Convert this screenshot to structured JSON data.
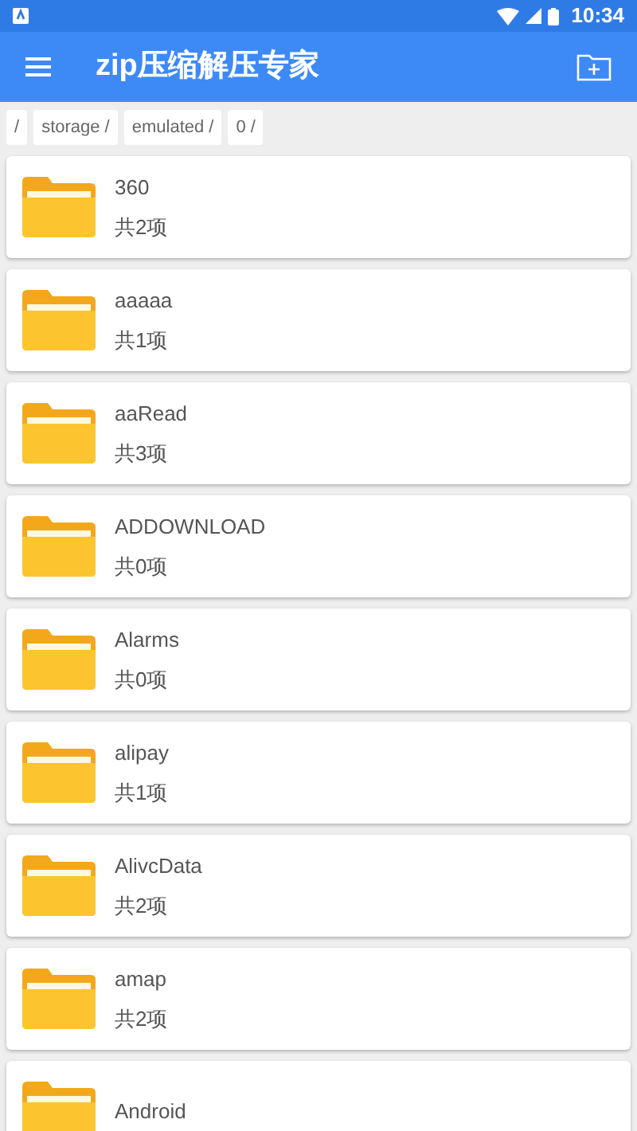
{
  "status_bar": {
    "time": "10:34"
  },
  "toolbar": {
    "title": "zip压缩解压专家"
  },
  "breadcrumb": [
    "/",
    "storage /",
    "emulated /",
    "0 /"
  ],
  "folders": [
    {
      "name": "360",
      "count": "共2项"
    },
    {
      "name": "aaaaa",
      "count": "共1项"
    },
    {
      "name": "aaRead",
      "count": "共3项"
    },
    {
      "name": "ADDOWNLOAD",
      "count": "共0项"
    },
    {
      "name": "Alarms",
      "count": "共0项"
    },
    {
      "name": "alipay",
      "count": "共1项"
    },
    {
      "name": "AlivcData",
      "count": "共2项"
    },
    {
      "name": "amap",
      "count": "共2项"
    },
    {
      "name": "Android"
    }
  ]
}
